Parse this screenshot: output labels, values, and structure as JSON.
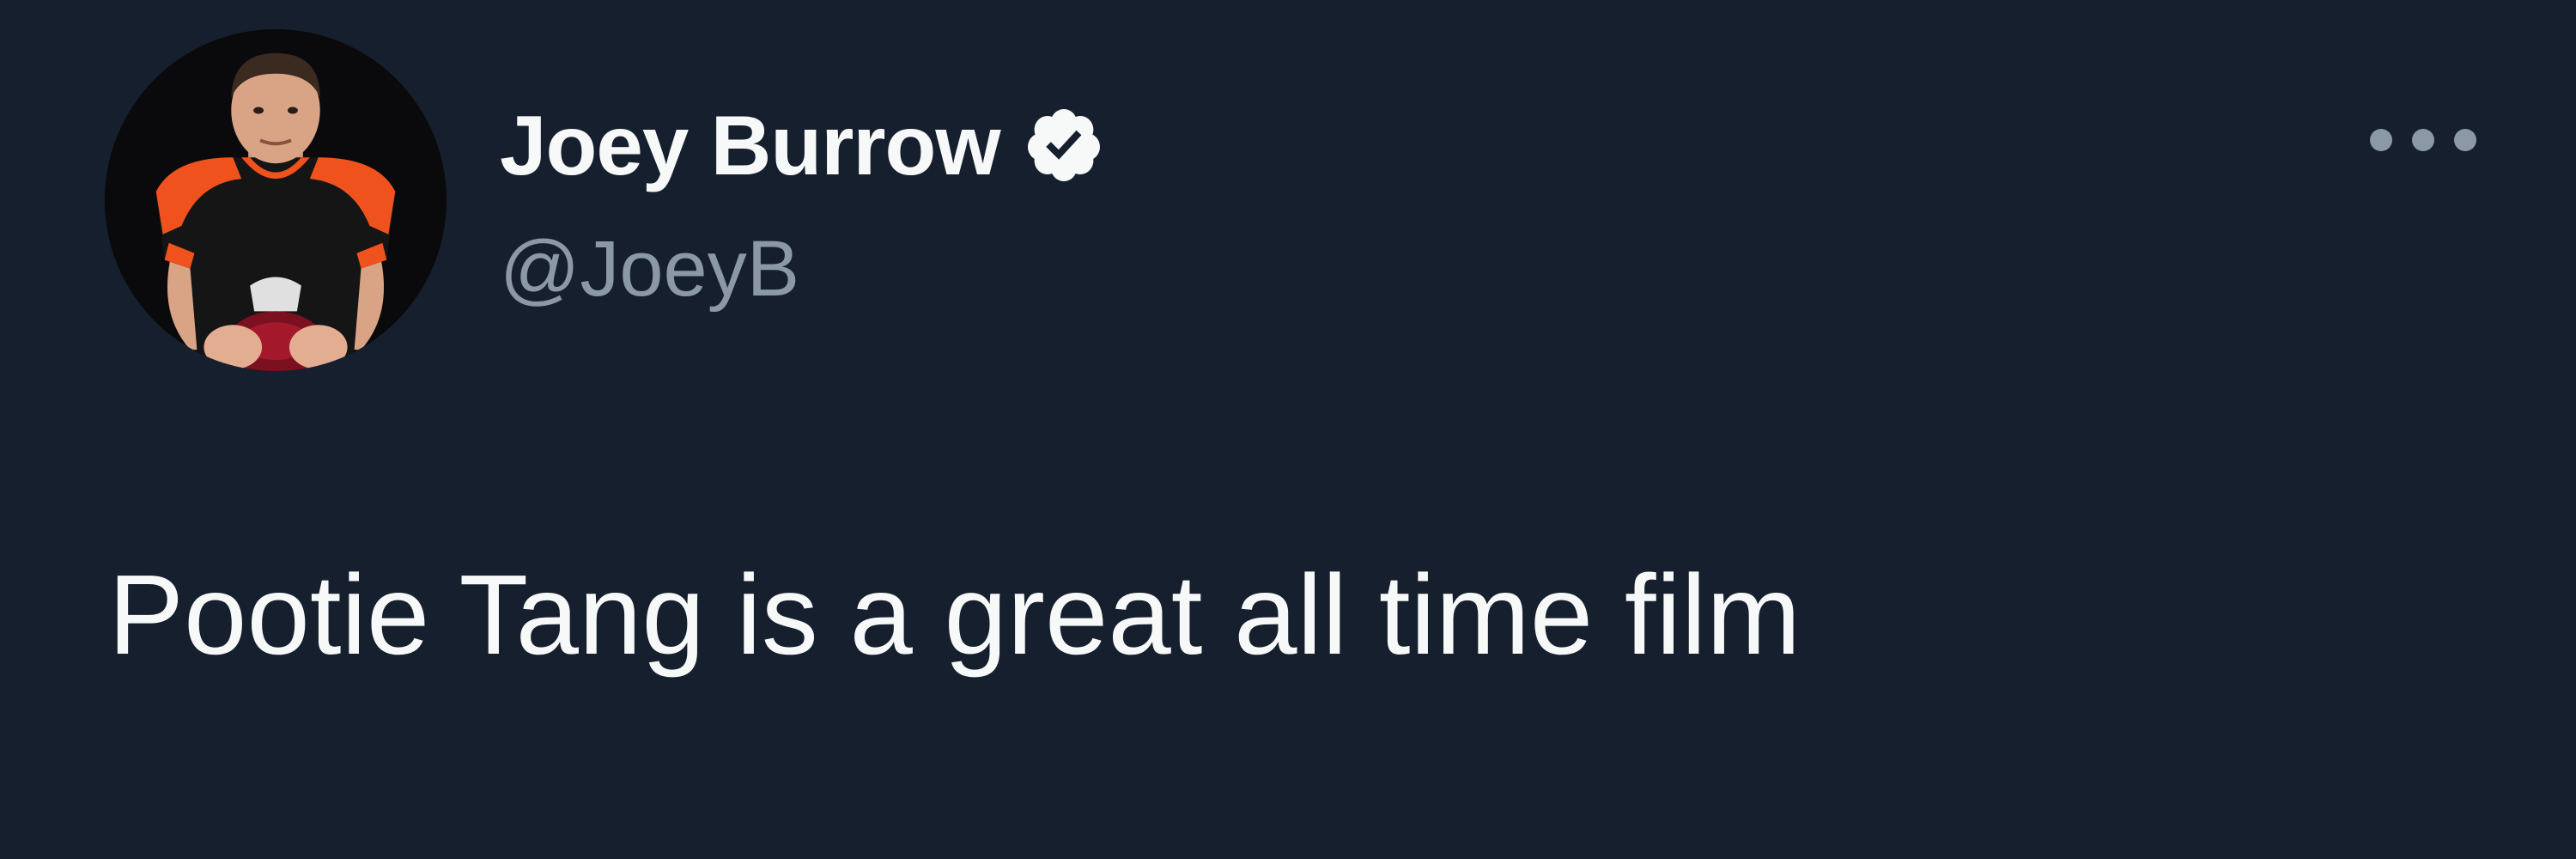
{
  "tweet": {
    "author": {
      "display_name": "Joey Burrow",
      "handle": "@JoeyB",
      "verified": true,
      "avatar_icon": "profile-photo-football-player"
    },
    "text": "Pootie Tang is a great all time film",
    "more_icon": "ellipsis-icon"
  },
  "colors": {
    "background": "#161f2d",
    "primary_text": "#f7f9f9",
    "secondary_text": "#8b98a5",
    "jersey_orange": "#f0521e",
    "jersey_black": "#151515"
  }
}
